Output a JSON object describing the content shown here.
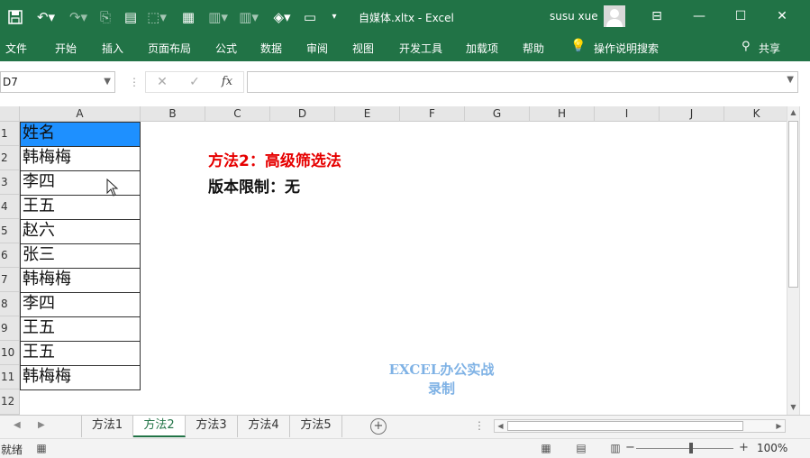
{
  "window": {
    "title": "自媒体.xltx - Excel",
    "user_name": "susu xue"
  },
  "ribbon": {
    "tabs": [
      "文件",
      "开始",
      "插入",
      "页面布局",
      "公式",
      "数据",
      "审阅",
      "视图",
      "开发工具",
      "加载项",
      "帮助"
    ],
    "tell_me": "操作说明搜索",
    "share": "共享"
  },
  "formula_bar": {
    "name_box": "D7",
    "formula": ""
  },
  "grid": {
    "columns": [
      "A",
      "B",
      "C",
      "D",
      "E",
      "F",
      "G",
      "H",
      "I",
      "J",
      "K"
    ],
    "rows": [
      "1",
      "2",
      "3",
      "4",
      "5",
      "6",
      "7",
      "8",
      "9",
      "10",
      "11",
      "12"
    ],
    "cells_A": [
      "姓名",
      "韩梅梅",
      "李四",
      "王五",
      "赵六",
      "张三",
      "韩梅梅",
      "李四",
      "王五",
      "王五",
      "韩梅梅"
    ]
  },
  "notes": {
    "method": "方法2：高级筛选法",
    "version_limit": "版本限制：无"
  },
  "watermark": {
    "line1": "EXCEL办公实战",
    "line2": "录制"
  },
  "sheets": {
    "tabs": [
      "方法1",
      "方法2",
      "方法3",
      "方法4",
      "方法5"
    ],
    "active": "方法2"
  },
  "statusbar": {
    "status": "就绪",
    "zoom": "100%"
  },
  "colors": {
    "excel_green": "#217346",
    "header_fill": "#1e90ff",
    "note_red": "#e60000",
    "watermark_blue": "#7fb2e5"
  }
}
